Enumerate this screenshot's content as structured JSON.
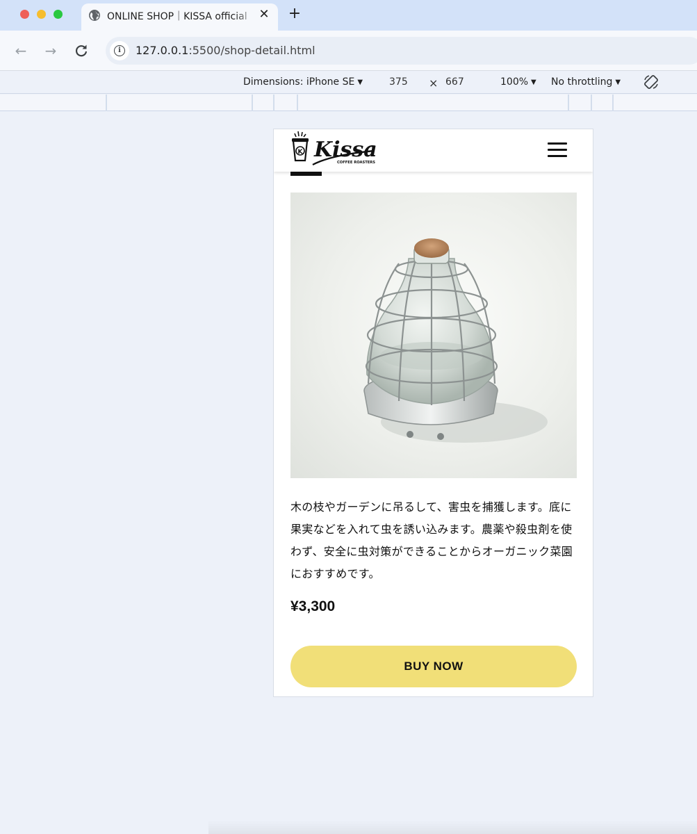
{
  "browser": {
    "tab_title": "ONLINE SHOP｜KISSA official",
    "tab_icon": "globe-icon",
    "close_glyph": "✕",
    "new_tab_glyph": "+",
    "url_host": "127.0.0.1",
    "url_path": ":5500/shop-detail.html"
  },
  "devtools": {
    "dimensions_label": "Dimensions: iPhone SE",
    "width": "375",
    "times": "×",
    "height": "667",
    "zoom": "100%",
    "throttling": "No throttling"
  },
  "site": {
    "logo_text": "Kissa",
    "logo_subtext": "COFFEE ROASTERS",
    "logo_mark": "K",
    "menu_icon": "hamburger-icon"
  },
  "product": {
    "image_subject": "glass-insect-trap-with-cork",
    "description": "木の枝やガーデンに吊るして、害虫を捕獲します。底に果実などを入れて虫を誘い込みます。農薬や殺虫剤を使わず、安全に虫対策ができることからオーガニック菜園におすすめです。",
    "price": "¥3,300",
    "buy_label": "BUY NOW"
  },
  "colors": {
    "buy_button": "#f1df78",
    "tab_bar": "#d3e2f9",
    "page_background": "#edf1f9"
  }
}
